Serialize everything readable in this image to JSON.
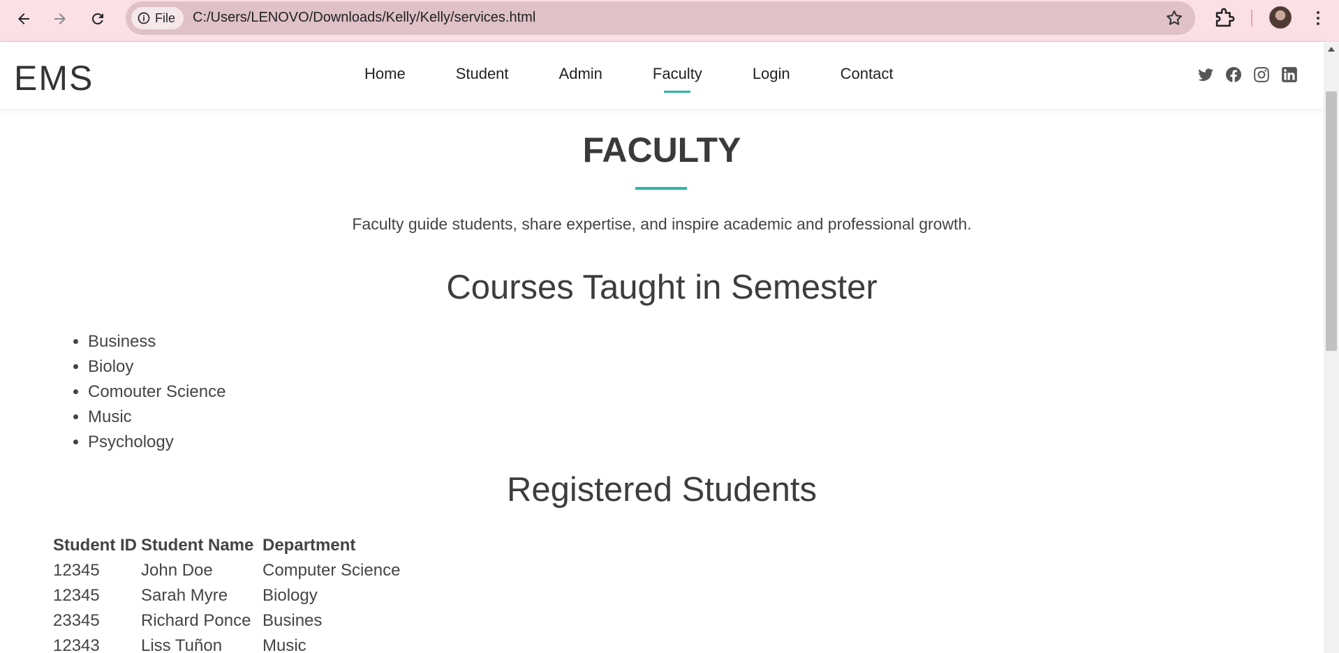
{
  "browser": {
    "site_chip": "File",
    "url": "C:/Users/LENOVO/Downloads/Kelly/Kelly/services.html"
  },
  "header": {
    "logo": "EMS",
    "nav": [
      {
        "label": "Home"
      },
      {
        "label": "Student"
      },
      {
        "label": "Admin"
      },
      {
        "label": "Faculty",
        "active": true
      },
      {
        "label": "Login"
      },
      {
        "label": "Contact"
      }
    ],
    "socials": [
      "twitter-icon",
      "facebook-icon",
      "instagram-icon",
      "linkedin-icon"
    ]
  },
  "main": {
    "title": "FACULTY",
    "intro": "Faculty guide students, share expertise, and inspire academic and professional growth.",
    "courses_heading": "Courses Taught in Semester",
    "courses": [
      "Business",
      "Bioloy",
      "Comouter Science",
      "Music",
      "Psychology"
    ],
    "students_heading": "Registered Students",
    "table": {
      "headers": [
        "Student ID",
        "Student Name",
        "Department"
      ],
      "rows": [
        [
          "12345",
          "John Doe",
          "Computer Science"
        ],
        [
          "12345",
          "Sarah Myre",
          "Biology"
        ],
        [
          "23345",
          "Richard Ponce",
          "Busines"
        ],
        [
          "12343",
          "Liss Tuñon",
          "Music"
        ]
      ]
    }
  },
  "colors": {
    "accent": "#2db5a6",
    "chrome_bg": "#fbe0e6"
  }
}
